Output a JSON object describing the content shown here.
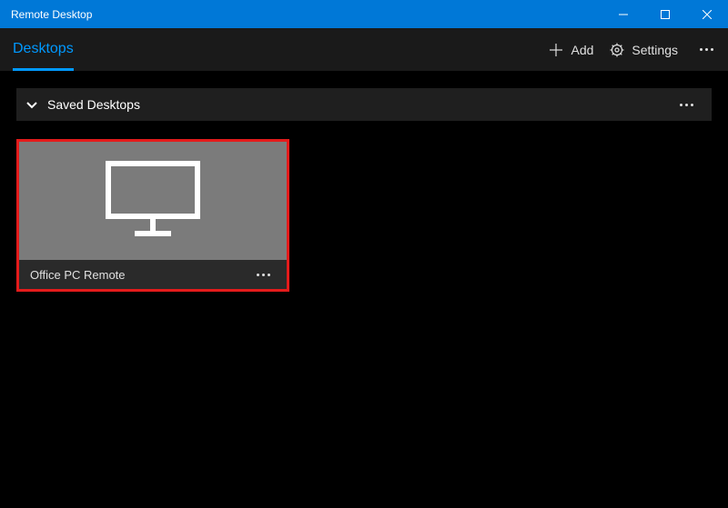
{
  "window": {
    "title": "Remote Desktop"
  },
  "toolbar": {
    "tab_label": "Desktops",
    "add_label": "Add",
    "settings_label": "Settings"
  },
  "section": {
    "title": "Saved Desktops"
  },
  "tiles": [
    {
      "name": "Office PC Remote"
    }
  ]
}
